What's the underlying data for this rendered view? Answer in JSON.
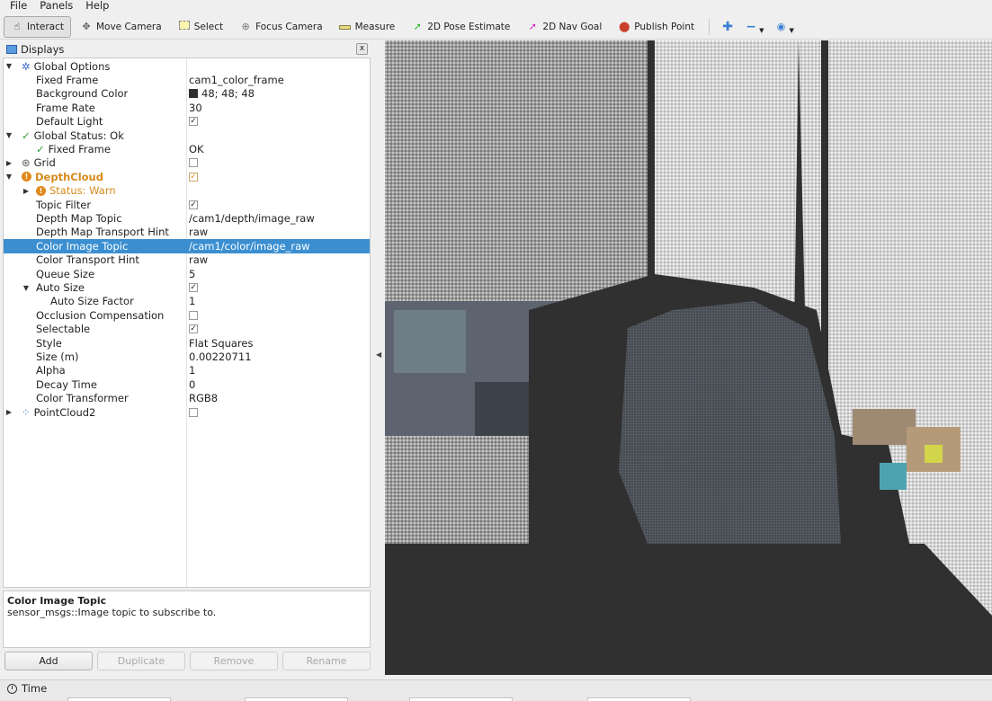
{
  "menu": [
    "File",
    "Panels",
    "Help"
  ],
  "toolbar": {
    "tools": [
      {
        "label": "Interact",
        "icon": "hand-icon",
        "glyph": "☝",
        "active": true
      },
      {
        "label": "Move Camera",
        "icon": "move-camera-icon",
        "glyph": "✥"
      },
      {
        "label": "Select",
        "icon": "select-icon",
        "glyph": "▭"
      },
      {
        "label": "Focus Camera",
        "icon": "focus-camera-icon",
        "glyph": "⊕"
      },
      {
        "label": "Measure",
        "icon": "ruler-icon",
        "glyph": "▬"
      },
      {
        "label": "2D Pose Estimate",
        "icon": "green-arrow-icon",
        "glyph": "➚"
      },
      {
        "label": "2D Nav Goal",
        "icon": "pink-arrow-icon",
        "glyph": "➚"
      },
      {
        "label": "Publish Point",
        "icon": "map-pin-icon",
        "glyph": "⬤"
      }
    ],
    "extra_icons": [
      "plus-icon",
      "minus-icon",
      "eye-icon"
    ]
  },
  "displays": {
    "title": "Displays",
    "close": "x",
    "rows": [
      {
        "name": "Global Options",
        "value": ""
      },
      {
        "name": "Fixed Frame",
        "value": "cam1_color_frame"
      },
      {
        "name": "Background Color",
        "value": "48; 48; 48"
      },
      {
        "name": "Frame Rate",
        "value": "30"
      },
      {
        "name": "Default Light",
        "value": ""
      },
      {
        "name": "Global Status: Ok",
        "value": ""
      },
      {
        "name": "Fixed Frame",
        "value": "OK"
      },
      {
        "name": "Grid",
        "value": ""
      },
      {
        "name": "DepthCloud",
        "value": ""
      },
      {
        "name": "Status: Warn",
        "value": ""
      },
      {
        "name": "Topic Filter",
        "value": ""
      },
      {
        "name": "Depth Map Topic",
        "value": "/cam1/depth/image_raw"
      },
      {
        "name": "Depth Map Transport Hint",
        "value": "raw"
      },
      {
        "name": "Color Image Topic",
        "value": "/cam1/color/image_raw"
      },
      {
        "name": "Color Transport Hint",
        "value": "raw"
      },
      {
        "name": "Queue Size",
        "value": "5"
      },
      {
        "name": "Auto Size",
        "value": ""
      },
      {
        "name": "Auto Size Factor",
        "value": "1"
      },
      {
        "name": "Occlusion Compensation",
        "value": ""
      },
      {
        "name": "Selectable",
        "value": ""
      },
      {
        "name": "Style",
        "value": "Flat Squares"
      },
      {
        "name": "Size (m)",
        "value": "0.00220711"
      },
      {
        "name": "Alpha",
        "value": "1"
      },
      {
        "name": "Decay Time",
        "value": "0"
      },
      {
        "name": "Color Transformer",
        "value": "RGB8"
      },
      {
        "name": "PointCloud2",
        "value": ""
      }
    ],
    "checked": {
      "default_light": true,
      "grid": false,
      "depthcloud": true,
      "topic_filter": true,
      "auto_size": true,
      "occlusion": false,
      "selectable": true,
      "pointcloud2": false
    },
    "selected_row": "Color Image Topic",
    "background_color": "#303030"
  },
  "description": {
    "title": "Color Image Topic",
    "text": "sensor_msgs::Image topic to subscribe to."
  },
  "buttons": {
    "add": "Add",
    "duplicate": "Duplicate",
    "remove": "Remove",
    "rename": "Rename"
  },
  "time_panel": {
    "title": "Time"
  },
  "colors": {
    "selection": "#3b8fd1",
    "warn": "#d68a1a",
    "ok": "#2e9a2e"
  }
}
